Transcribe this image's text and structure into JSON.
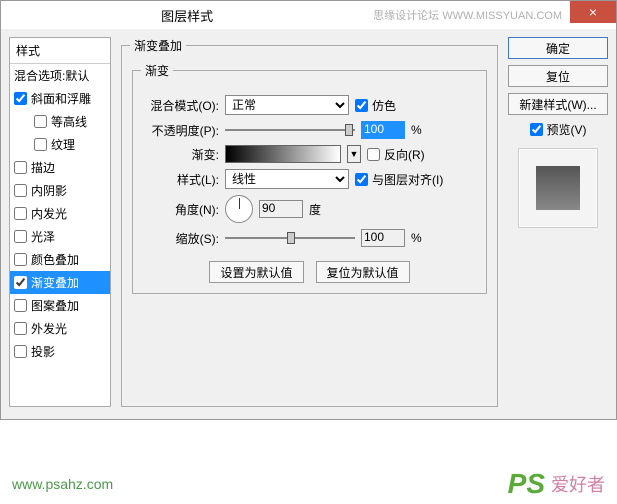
{
  "titlebar": {
    "title": "图层样式",
    "watermark": "思缘设计论坛  WWW.MISSYUAN.COM",
    "close": "×"
  },
  "styles": {
    "header": "样式",
    "blendDefault": "混合选项:默认",
    "items": [
      {
        "label": "斜面和浮雕",
        "checked": true
      },
      {
        "label": "等高线",
        "checked": false,
        "indent": true
      },
      {
        "label": "纹理",
        "checked": false,
        "indent": true
      },
      {
        "label": "描边",
        "checked": false
      },
      {
        "label": "内阴影",
        "checked": false
      },
      {
        "label": "内发光",
        "checked": false
      },
      {
        "label": "光泽",
        "checked": false
      },
      {
        "label": "颜色叠加",
        "checked": false
      },
      {
        "label": "渐变叠加",
        "checked": true,
        "selected": true
      },
      {
        "label": "图案叠加",
        "checked": false
      },
      {
        "label": "外发光",
        "checked": false
      },
      {
        "label": "投影",
        "checked": false
      }
    ]
  },
  "panel": {
    "outerLegend": "渐变叠加",
    "innerLegend": "渐变",
    "blendModeLabel": "混合模式(O):",
    "blendMode": "正常",
    "dither": "仿色",
    "opacityLabel": "不透明度(P):",
    "opacity": "100",
    "pct": "%",
    "gradientLabel": "渐变:",
    "reverse": "反向(R)",
    "styleLabel": "样式(L):",
    "style": "线性",
    "alignLayer": "与图层对齐(I)",
    "angleLabel": "角度(N):",
    "angle": "90",
    "deg": "度",
    "scaleLabel": "缩放(S):",
    "scale": "100",
    "setDefault": "设置为默认值",
    "resetDefault": "复位为默认值"
  },
  "side": {
    "ok": "确定",
    "reset": "复位",
    "newStyle": "新建样式(W)...",
    "preview": "预览(V)"
  },
  "footer": {
    "url": "www.psahz.com",
    "ps": "PS",
    "cn": "爱好者"
  }
}
